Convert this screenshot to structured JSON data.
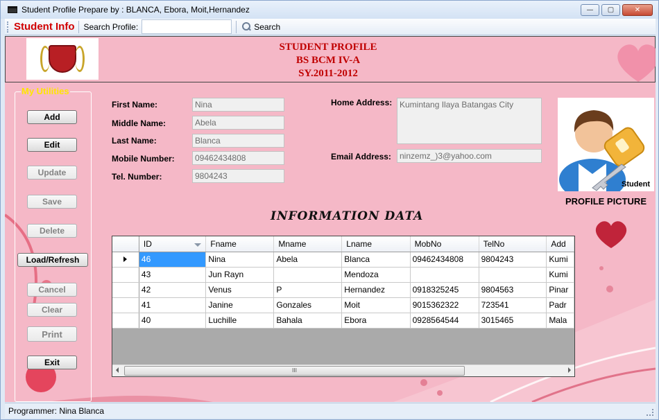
{
  "window": {
    "title": "Student Profile  Prepare by : BLANCA, Ebora, Moit,Hernandez",
    "controls": {
      "minimize": "—",
      "maximize": "▢",
      "close": "✕"
    }
  },
  "toolbar": {
    "title": "Student Info",
    "search_label": "Search Profile:",
    "search_value": "",
    "search_button": "Search"
  },
  "header": {
    "line1": "STUDENT PROFILE",
    "line2": "BS BCM IV-A",
    "line3": "SY.2011-2012"
  },
  "utilities": {
    "legend": "My Utilities",
    "buttons": {
      "add": "Add",
      "edit": "Edit",
      "update": "Update",
      "save": "Save",
      "delete": "Delete",
      "load_refresh": "Load/Refresh",
      "cancel": "Cancel",
      "clear": "Clear",
      "print": "Print",
      "exit": "Exit"
    }
  },
  "form": {
    "first_name": {
      "label": "First Name:",
      "value": "Nina"
    },
    "middle_name": {
      "label": "Middle Name:",
      "value": "Abela"
    },
    "last_name": {
      "label": "Last Name:",
      "value": "Blanca"
    },
    "mobile_number": {
      "label": "Mobile Number:",
      "value": "09462434808"
    },
    "tel_number": {
      "label": "Tel.  Number:",
      "value": "9804243"
    },
    "home_address": {
      "label": "Home Address:",
      "value": "Kumintang Ilaya Batangas City"
    },
    "email_address": {
      "label": "Email Address:",
      "value": "ninzemz_)3@yahoo.com"
    }
  },
  "profile_picture": {
    "caption": "PROFILE PICTURE",
    "image_label": "Student"
  },
  "section_title": "INFORMATION DATA",
  "grid": {
    "columns": [
      "ID",
      "Fname",
      "Mname",
      "Lname",
      "MobNo",
      "TelNo",
      "Add"
    ],
    "rows": [
      [
        "46",
        "Nina",
        "Abela",
        "Blanca",
        "09462434808",
        "9804243",
        "Kumi"
      ],
      [
        "43",
        "Jun Rayn",
        "",
        "Mendoza",
        "",
        "",
        "Kumi"
      ],
      [
        "42",
        "Venus",
        "P",
        "Hernandez",
        "0918325245",
        "9804563",
        "Pinar"
      ],
      [
        "41",
        "Janine",
        "Gonzales",
        "Moit",
        "9015362322",
        "723541",
        "Padr"
      ],
      [
        "40",
        "Luchille",
        "Bahala",
        "Ebora",
        "0928564544",
        "3015465",
        "Mala"
      ]
    ],
    "scroll_thumb": "III"
  },
  "status": {
    "text": "Programmer: Nina Blanca"
  },
  "colors": {
    "background": "#f5b8c7",
    "accent_red": "#c00000",
    "title_red": "#d10000",
    "legend_yellow": "#ffe600",
    "selection_blue": "#3399ff",
    "heart": "#c0243a"
  }
}
